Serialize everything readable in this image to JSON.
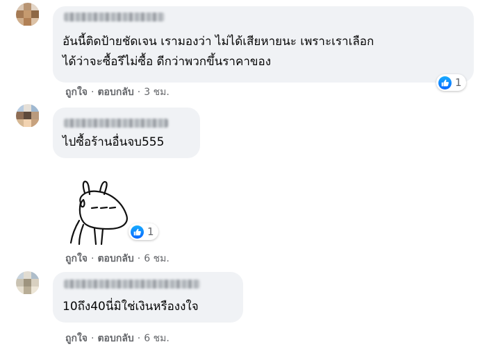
{
  "comments": [
    {
      "text_lines": [
        "อันนี้ติดป้ายชัดเจน เรามองว่า ไม่ได้เสียหายนะ เพราะเราเลือก",
        "ได้ว่าจะซื้อรึไม่ซื้อ ดีกว่าพวกขึ้นราคาของ"
      ],
      "reaction_count": "1",
      "like_label": "ถูกใจ",
      "reply_label": "ตอบกลับ",
      "time": "3 ชม."
    },
    {
      "text": "ไปซื้อร้านอื่นจบ555",
      "sticker": "bunny-sweat-sticker",
      "reaction_count": "1",
      "like_label": "ถูกใจ",
      "reply_label": "ตอบกลับ",
      "time": "6 ชม."
    },
    {
      "text": "10ถึง40นี่มิใช่เงินหรืองงใจ",
      "like_label": "ถูกใจ",
      "reply_label": "ตอบกลับ",
      "time": "6 ชม."
    }
  ],
  "separator": "·",
  "colors": {
    "bubble": "#f0f2f5",
    "meta": "#65676b",
    "like_blue": "#0866ff"
  }
}
